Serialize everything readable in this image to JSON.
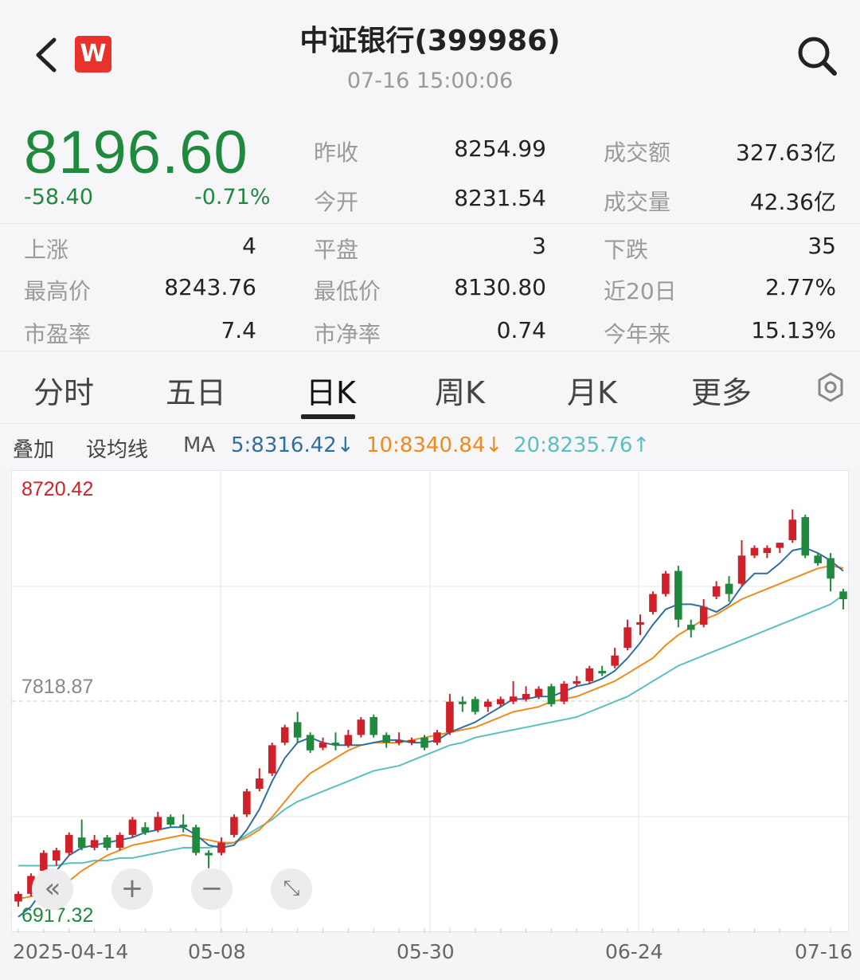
{
  "header": {
    "title": "中证银行(399986)",
    "timestamp": "07-16 15:00:06",
    "logo_text": "W"
  },
  "quote": {
    "price": "8196.60",
    "change": "-58.40",
    "change_pct": "-0.71%",
    "prev_close_label": "昨收",
    "prev_close": "8254.99",
    "open_label": "今开",
    "open": "8231.54",
    "turnover_label": "成交额",
    "turnover": "327.63亿",
    "volume_label": "成交量",
    "volume": "42.36亿",
    "up_label": "上涨",
    "up": "4",
    "flat_label": "平盘",
    "flat": "3",
    "down_label": "下跌",
    "down": "35",
    "high_label": "最高价",
    "high": "8243.76",
    "low_label": "最低价",
    "low": "8130.80",
    "d20_label": "近20日",
    "d20": "2.77%",
    "pe_label": "市盈率",
    "pe": "7.4",
    "pb_label": "市净率",
    "pb": "0.74",
    "ytd_label": "今年来",
    "ytd": "15.13%"
  },
  "tabs": [
    "分时",
    "五日",
    "日K",
    "周K",
    "月K",
    "更多"
  ],
  "active_tab": "日K",
  "ma_bar": {
    "overlay": "叠加",
    "set_ma": "设均线",
    "ma": "MA",
    "ma5": "5:8316.42↓",
    "ma10": "10:8340.84↓",
    "ma20": "20:8235.76↑"
  },
  "colors": {
    "down_green": "#1f8a3e",
    "up_red": "#d0202a",
    "ma5": "#2f6f9e",
    "ma10": "#f08a1c",
    "ma20": "#5bbfc0"
  },
  "icons": [
    "back-arrow-icon",
    "search-icon",
    "settings-gear-icon",
    "rewind-icon",
    "zoom-in-icon",
    "zoom-out-icon",
    "fullscreen-icon"
  ],
  "chart_data": {
    "type": "candlestick",
    "y_top_label": "8720.42",
    "y_mid_label": "7818.87",
    "y_bottom_label": "6917.32",
    "ylim": [
      6917.32,
      8720.42
    ],
    "x_labels": [
      "2025-04-14",
      "05-08",
      "05-30",
      "06-24",
      "07-16"
    ],
    "candles": [
      [
        7040,
        7070,
        7020,
        7080
      ],
      [
        7070,
        7140,
        7060,
        7150
      ],
      [
        7160,
        7230,
        7150,
        7240
      ],
      [
        7200,
        7240,
        7180,
        7250
      ],
      [
        7230,
        7300,
        7220,
        7310
      ],
      [
        7290,
        7250,
        7240,
        7360
      ],
      [
        7250,
        7280,
        7240,
        7300
      ],
      [
        7290,
        7250,
        7240,
        7300
      ],
      [
        7250,
        7300,
        7240,
        7310
      ],
      [
        7300,
        7360,
        7290,
        7370
      ],
      [
        7330,
        7310,
        7300,
        7350
      ],
      [
        7320,
        7370,
        7310,
        7390
      ],
      [
        7370,
        7340,
        7330,
        7380
      ],
      [
        7340,
        7330,
        7310,
        7380
      ],
      [
        7330,
        7230,
        7220,
        7340
      ],
      [
        7230,
        7220,
        7170,
        7240
      ],
      [
        7230,
        7270,
        7220,
        7290
      ],
      [
        7300,
        7370,
        7290,
        7380
      ],
      [
        7380,
        7470,
        7370,
        7480
      ],
      [
        7480,
        7520,
        7470,
        7560
      ],
      [
        7540,
        7650,
        7530,
        7660
      ],
      [
        7660,
        7720,
        7650,
        7730
      ],
      [
        7740,
        7680,
        7660,
        7780
      ],
      [
        7690,
        7630,
        7620,
        7700
      ],
      [
        7640,
        7660,
        7630,
        7680
      ],
      [
        7660,
        7650,
        7630,
        7700
      ],
      [
        7650,
        7690,
        7640,
        7710
      ],
      [
        7690,
        7750,
        7680,
        7760
      ],
      [
        7760,
        7690,
        7680,
        7770
      ],
      [
        7690,
        7660,
        7640,
        7700
      ],
      [
        7660,
        7670,
        7650,
        7700
      ],
      [
        7660,
        7670,
        7650,
        7680
      ],
      [
        7680,
        7640,
        7630,
        7690
      ],
      [
        7660,
        7700,
        7650,
        7710
      ],
      [
        7700,
        7820,
        7690,
        7850
      ],
      [
        7820,
        7810,
        7780,
        7840
      ],
      [
        7830,
        7780,
        7770,
        7840
      ],
      [
        7800,
        7820,
        7780,
        7830
      ],
      [
        7810,
        7830,
        7800,
        7840
      ],
      [
        7820,
        7840,
        7810,
        7900
      ],
      [
        7830,
        7850,
        7820,
        7880
      ],
      [
        7840,
        7870,
        7830,
        7880
      ],
      [
        7880,
        7810,
        7800,
        7890
      ],
      [
        7820,
        7890,
        7810,
        7900
      ],
      [
        7890,
        7900,
        7880,
        7920
      ],
      [
        7900,
        7950,
        7890,
        7960
      ],
      [
        7940,
        7930,
        7920,
        7960
      ],
      [
        7960,
        8000,
        7950,
        8030
      ],
      [
        8030,
        8110,
        8020,
        8140
      ],
      [
        8120,
        8130,
        8080,
        8160
      ],
      [
        8170,
        8240,
        8160,
        8250
      ],
      [
        8240,
        8320,
        8230,
        8330
      ],
      [
        8330,
        8140,
        8110,
        8350
      ],
      [
        8120,
        8100,
        8070,
        8140
      ],
      [
        8120,
        8190,
        8110,
        8220
      ],
      [
        8230,
        8270,
        8220,
        8290
      ],
      [
        8280,
        8240,
        8210,
        8310
      ],
      [
        8280,
        8390,
        8270,
        8450
      ],
      [
        8390,
        8420,
        8380,
        8430
      ],
      [
        8400,
        8420,
        8380,
        8430
      ],
      [
        8420,
        8440,
        8400,
        8440
      ],
      [
        8450,
        8530,
        8440,
        8570
      ],
      [
        8540,
        8390,
        8380,
        8550
      ],
      [
        8390,
        8360,
        8350,
        8400
      ],
      [
        8380,
        8300,
        8250,
        8400
      ],
      [
        8250,
        8220,
        8180,
        8260
      ]
    ],
    "ma5": [
      6980,
      7020,
      7090,
      7160,
      7220,
      7250,
      7260,
      7270,
      7280,
      7290,
      7310,
      7320,
      7330,
      7330,
      7300,
      7260,
      7250,
      7260,
      7320,
      7400,
      7510,
      7600,
      7660,
      7680,
      7660,
      7650,
      7650,
      7650,
      7660,
      7670,
      7670,
      7660,
      7660,
      7670,
      7700,
      7720,
      7740,
      7770,
      7800,
      7830,
      7830,
      7840,
      7840,
      7860,
      7880,
      7890,
      7910,
      7940,
      7990,
      8050,
      8120,
      8180,
      8200,
      8200,
      8190,
      8170,
      8200,
      8270,
      8320,
      8320,
      8360,
      8410,
      8420,
      8400,
      8370,
      8330
    ],
    "ma10": [
      7050,
      7060,
      7070,
      7090,
      7120,
      7160,
      7190,
      7220,
      7240,
      7260,
      7270,
      7280,
      7290,
      7300,
      7290,
      7280,
      7270,
      7270,
      7290,
      7320,
      7370,
      7430,
      7490,
      7540,
      7570,
      7600,
      7630,
      7650,
      7660,
      7660,
      7660,
      7670,
      7680,
      7690,
      7700,
      7710,
      7720,
      7740,
      7760,
      7780,
      7790,
      7800,
      7820,
      7830,
      7840,
      7860,
      7880,
      7900,
      7930,
      7960,
      7990,
      8040,
      8080,
      8110,
      8140,
      8160,
      8190,
      8220,
      8240,
      8260,
      8280,
      8300,
      8320,
      8340,
      8350,
      8341
    ],
    "ma20": [
      7180,
      7180,
      7180,
      7180,
      7190,
      7190,
      7200,
      7200,
      7210,
      7210,
      7220,
      7230,
      7240,
      7250,
      7250,
      7250,
      7260,
      7270,
      7300,
      7330,
      7360,
      7400,
      7430,
      7450,
      7470,
      7490,
      7510,
      7530,
      7550,
      7560,
      7570,
      7590,
      7610,
      7630,
      7650,
      7660,
      7680,
      7690,
      7700,
      7710,
      7720,
      7730,
      7740,
      7750,
      7760,
      7780,
      7800,
      7820,
      7840,
      7870,
      7900,
      7930,
      7960,
      7980,
      8000,
      8020,
      8040,
      8060,
      8080,
      8100,
      8120,
      8140,
      8160,
      8180,
      8200,
      8236
    ]
  }
}
